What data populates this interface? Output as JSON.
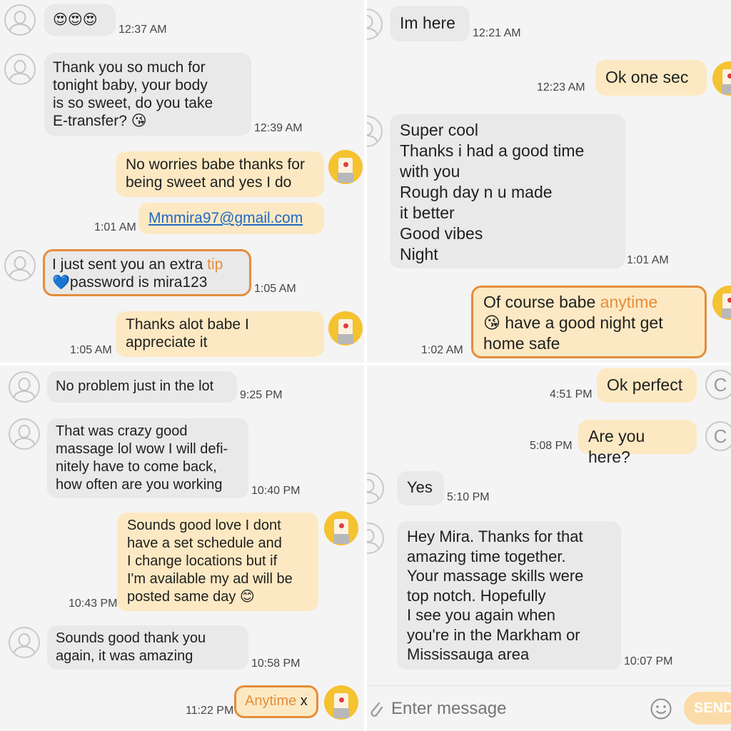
{
  "panel1": {
    "messages": [
      {
        "text": "😍😍😍",
        "time": "12:37 AM"
      },
      {
        "text": "Thank you so much for\ntonight baby, your body\nis so sweet, do you take\nE-transfer? 😘",
        "time": "12:39 AM"
      },
      {
        "text": "No worries babe thanks for\nbeing sweet and yes I do"
      },
      {
        "text": "Mmmira97@gmail.com",
        "time": "1:01 AM"
      },
      {
        "text_a": "I just sent you an extra ",
        "text_b": "tip",
        "text_c": "password is mira123",
        "heart": "💙",
        "time": "1:05 AM"
      },
      {
        "text": "Thanks alot babe I\nappreciate it",
        "time": "1:05 AM"
      }
    ]
  },
  "panel2": {
    "messages": [
      {
        "text": "Im here",
        "time": "12:21 AM"
      },
      {
        "text": "Ok one sec",
        "time": "12:23 AM"
      },
      {
        "text": "Super cool\nThanks i had a good time\nwith you\nRough day n u made\nit better\nGood vibes\nNight",
        "time": "1:01 AM"
      },
      {
        "text_a": "Of course babe ",
        "text_b": "anytime",
        "emoji": "😘",
        "text_c": " have a good night get\nhome safe",
        "time": "1:02 AM"
      }
    ]
  },
  "panel3": {
    "messages": [
      {
        "text": "No problem just in the lot",
        "time": "9:25 PM"
      },
      {
        "text": "That was crazy good\nmassage lol wow I will defi-\nnitely have to come back,\nhow often are you working",
        "time": "10:40 PM"
      },
      {
        "text": "Sounds good love I dont\nhave a set schedule and\nI change locations but if\nI'm available my ad will be\nposted same day ",
        "emoji": "😊",
        "time": "10:43 PM"
      },
      {
        "text": "Sounds good thank you\nagain, it was amazing",
        "time": "10:58 PM"
      },
      {
        "text_a": "Anytime",
        "text_b": " x",
        "time": "11:22 PM"
      }
    ]
  },
  "panel4": {
    "messages": [
      {
        "text": "Ok perfect",
        "time": "4:51 PM"
      },
      {
        "text": "Are you here?",
        "time": "5:08 PM"
      },
      {
        "text": "Yes",
        "time": "5:10 PM"
      },
      {
        "text": "Hey Mira. Thanks for that\namazing time together.\nYour massage skills were\ntop notch. Hopefully\nI see you again when\nyou're in the Markham or\nMississauga area",
        "time": "10:07 PM"
      }
    ],
    "contact_initial": "C",
    "input": {
      "placeholder": "Enter message",
      "send_label": "SEND"
    }
  },
  "colors": {
    "incoming": "#e9e9e9",
    "outgoing": "#fce9c3",
    "accent": "#e48d3c",
    "link": "#2368c5"
  },
  "icons": [
    "contact-avatar-icon",
    "user-avatar-icon",
    "attach-icon",
    "emoji-icon"
  ]
}
